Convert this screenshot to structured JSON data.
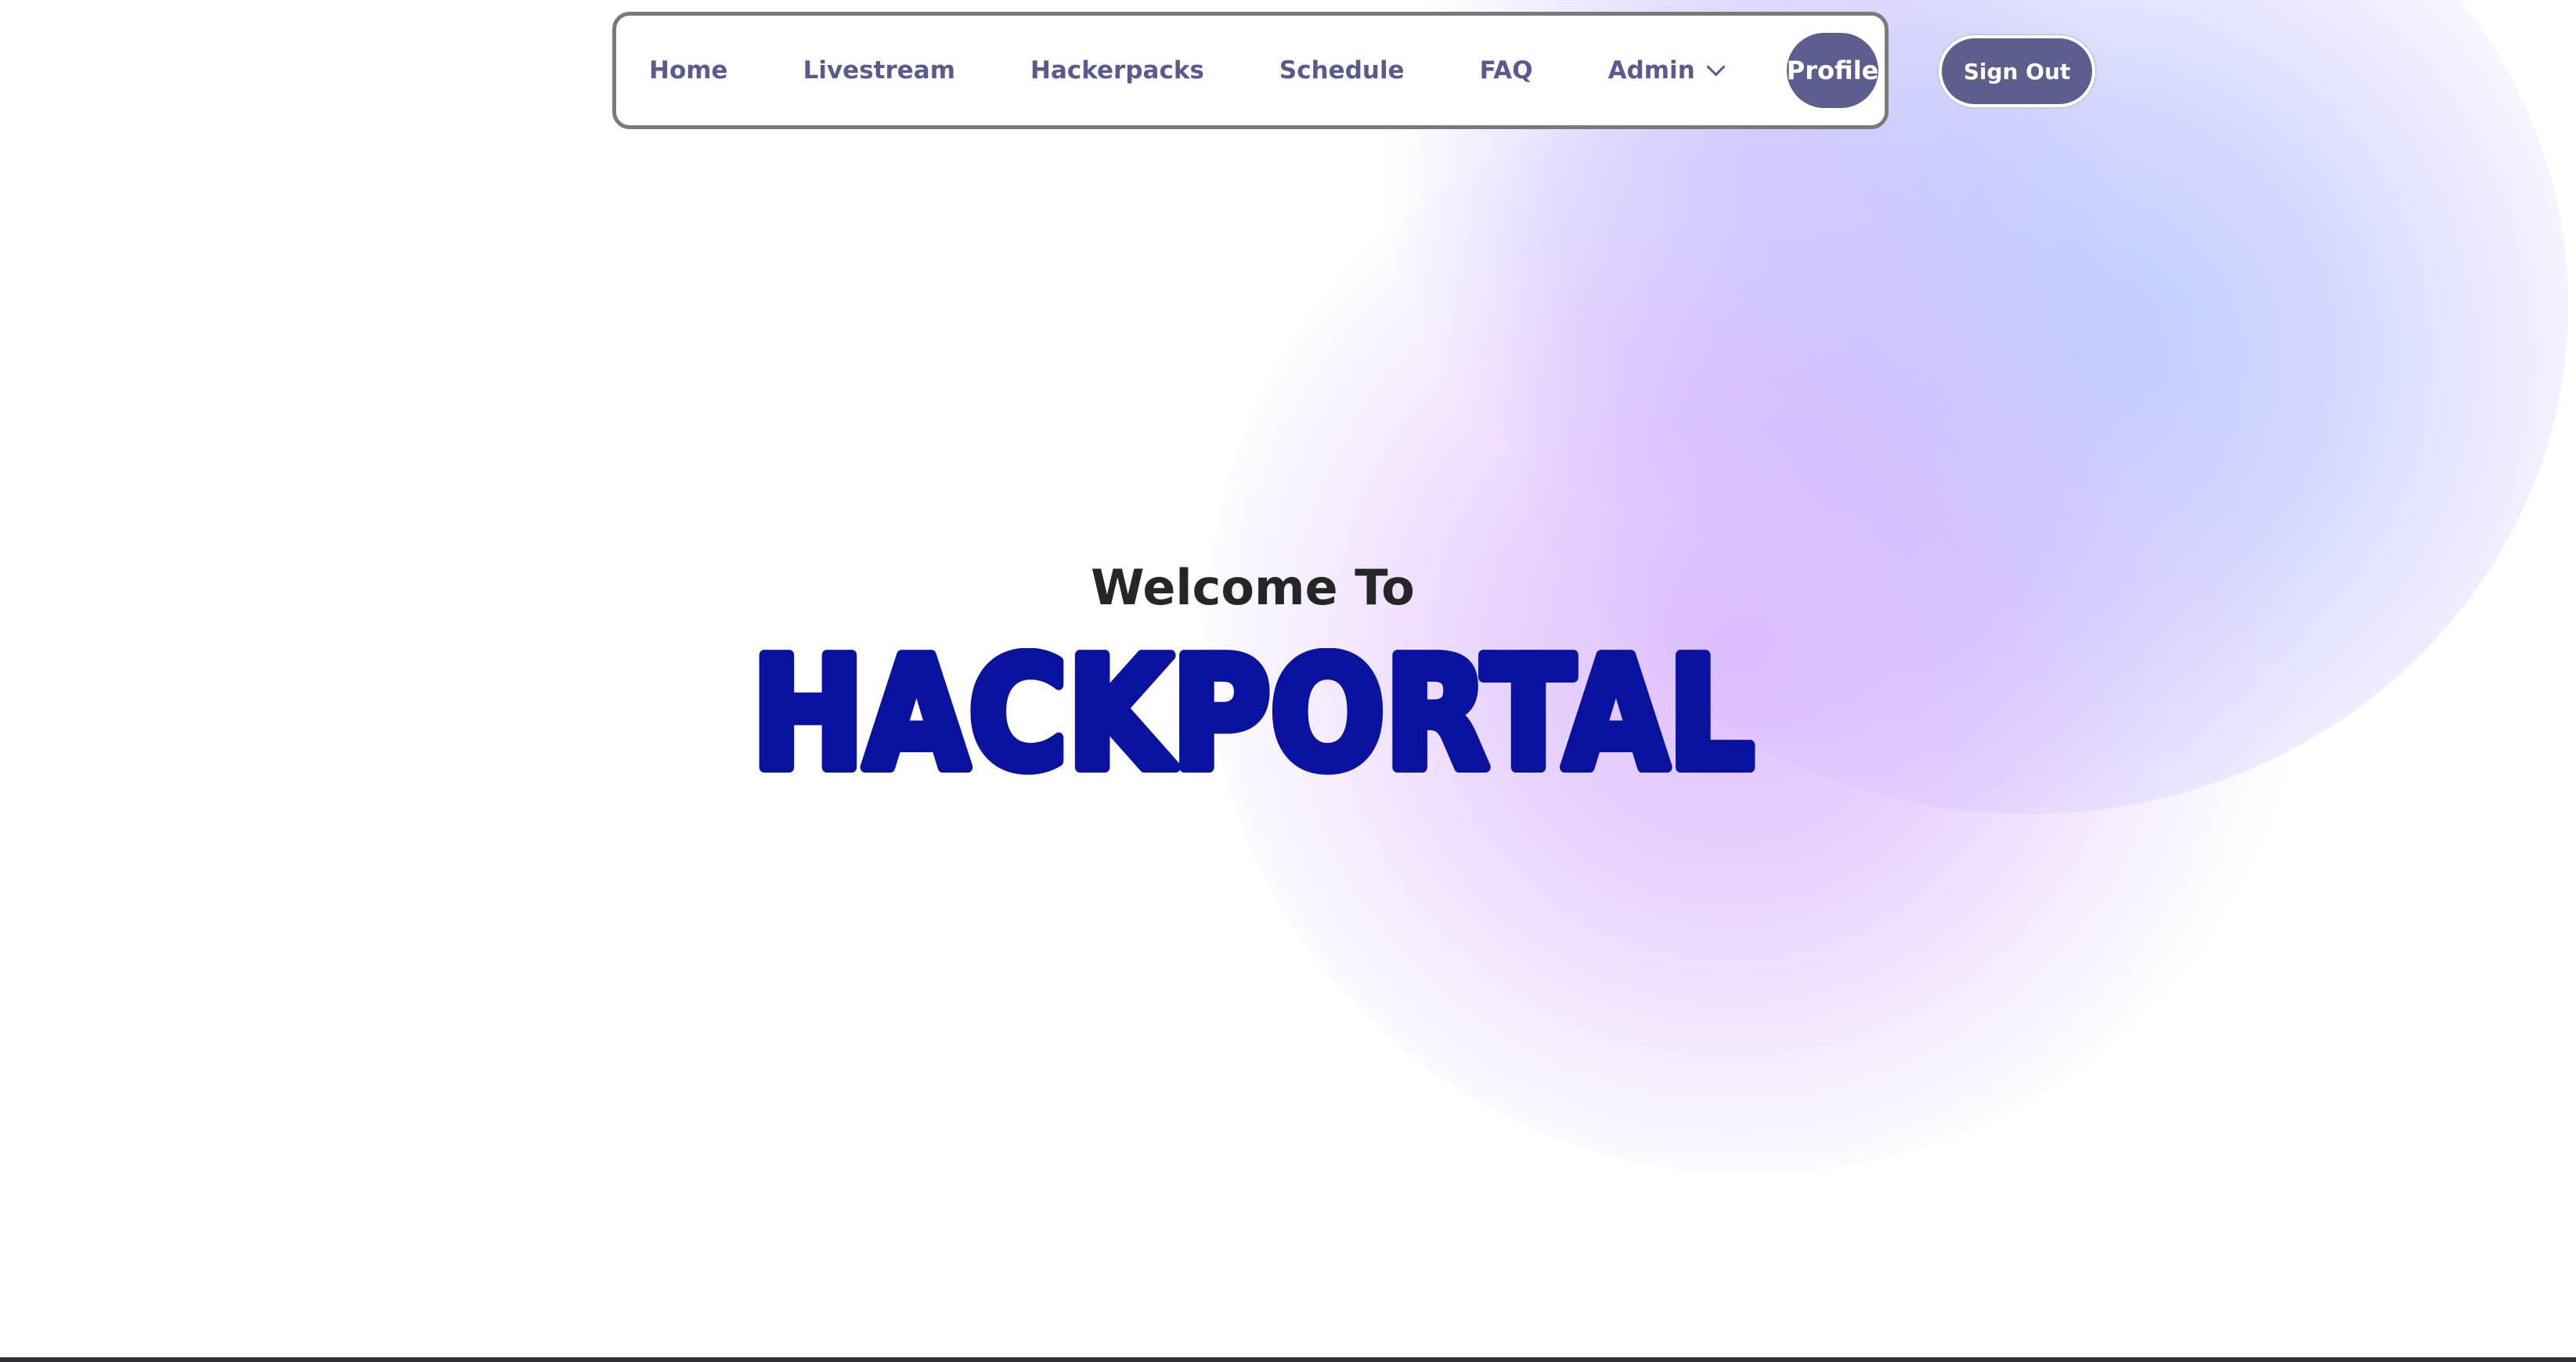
{
  "navbar": {
    "items": [
      {
        "label": "Home"
      },
      {
        "label": "Livestream"
      },
      {
        "label": "Hackerpacks"
      },
      {
        "label": "Schedule"
      },
      {
        "label": "FAQ"
      }
    ],
    "admin_label": "Admin",
    "admin_icon": "chevron-down-icon",
    "profile_label": "Profile"
  },
  "header": {
    "signout_label": "Sign Out"
  },
  "hero": {
    "welcome": "Welcome To",
    "logo_text": "HACKPORTAL",
    "logo_color": "#0a12a0"
  },
  "colors": {
    "nav_text": "#5a5a8e",
    "button_bg": "#5e5d8f",
    "nav_border": "#7a7a7a",
    "heading_text": "#262626"
  }
}
